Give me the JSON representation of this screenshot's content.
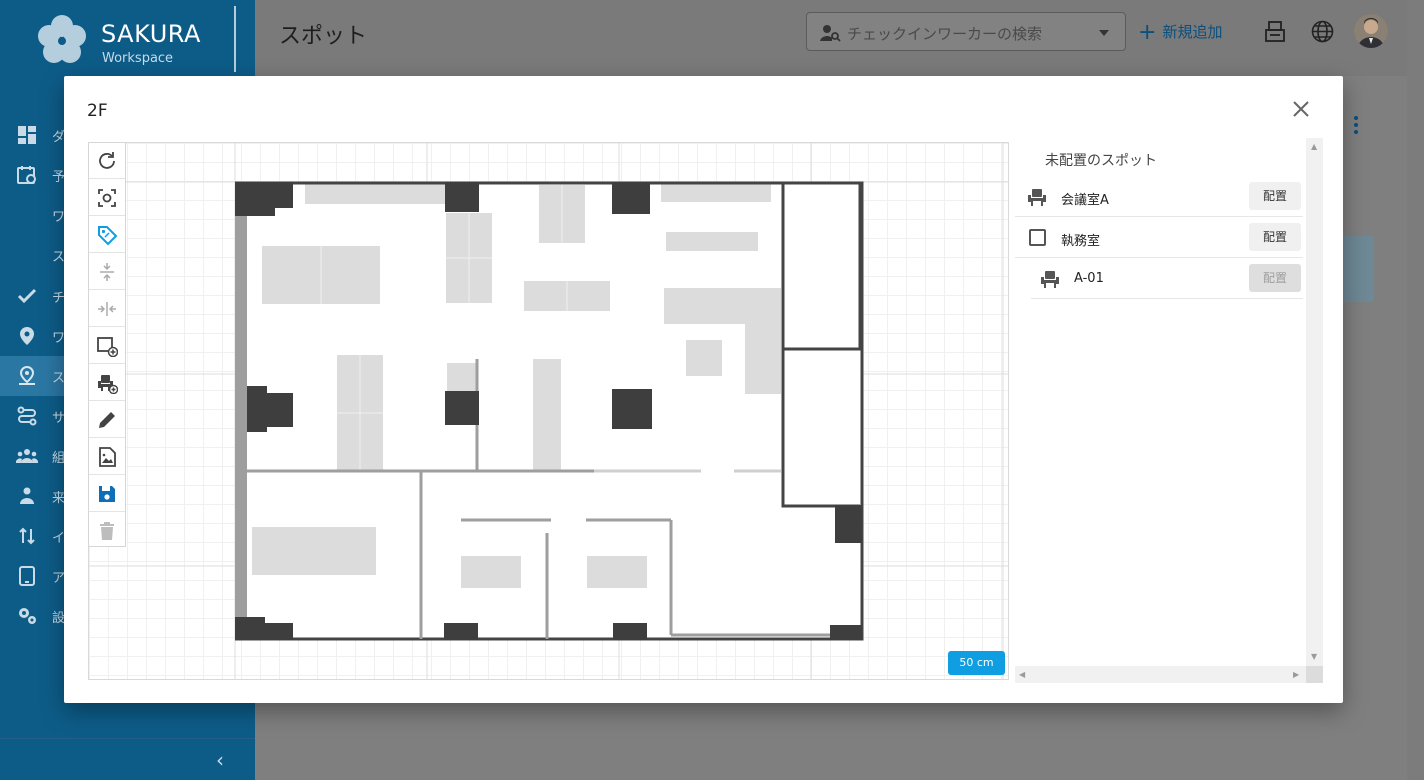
{
  "app": {
    "brand": "SAKURA",
    "brand_sub": "Workspace",
    "page_title": "スポット",
    "search_placeholder": "チェックインワーカーの検索",
    "add_new_label": "新規追加",
    "accent_color": "#0e9ee1",
    "sidebar_color": "#0d5c88"
  },
  "sidebar": {
    "items": [
      {
        "label": "ダ",
        "icon": "dashboard-icon"
      },
      {
        "label": "予",
        "icon": "calendar-icon"
      },
      {
        "label": "ワ",
        "icon": ""
      },
      {
        "label": "ス",
        "icon": ""
      },
      {
        "label": "チ",
        "icon": "check-icon"
      },
      {
        "label": "ワ",
        "icon": "location-pin-icon"
      },
      {
        "label": "ス",
        "icon": "spot-person-icon"
      },
      {
        "label": "サ",
        "icon": "route-icon"
      },
      {
        "label": "組",
        "icon": "group-icon"
      },
      {
        "label": "来",
        "icon": "visitor-icon"
      },
      {
        "label": "イ",
        "icon": "import-export-icon"
      },
      {
        "label": "ア",
        "icon": "tablet-icon"
      },
      {
        "label": "設",
        "icon": "settings-icon"
      }
    ]
  },
  "modal": {
    "title": "2F",
    "scale_label": "50 cm",
    "toolbar": [
      {
        "name": "rotate-tool-button",
        "icon": "rotate-icon"
      },
      {
        "name": "fit-view-tool-button",
        "icon": "focus-frame-icon"
      },
      {
        "name": "label-tool-button",
        "icon": "tag-icon"
      },
      {
        "name": "vertical-align-tool-button",
        "icon": "vertical-compress-icon"
      },
      {
        "name": "horizontal-align-tool-button",
        "icon": "horizontal-compress-icon"
      },
      {
        "name": "add-area-tool-button",
        "icon": "add-rectangle-icon"
      },
      {
        "name": "add-seat-tool-button",
        "icon": "add-seat-icon"
      },
      {
        "name": "edit-tool-button",
        "icon": "pencil-icon"
      },
      {
        "name": "image-tool-button",
        "icon": "image-file-icon"
      },
      {
        "name": "save-tool-button",
        "icon": "save-icon"
      },
      {
        "name": "delete-tool-button",
        "icon": "trash-icon"
      }
    ]
  },
  "spots": {
    "heading": "未配置のスポット",
    "items": [
      {
        "name": "会議室A",
        "icon": "seat-icon",
        "button": "配置",
        "disabled": false
      },
      {
        "name": "執務室",
        "icon": "checkbox",
        "button": "配置",
        "disabled": false
      },
      {
        "name": "A-01",
        "icon": "seat-icon",
        "button": "配置",
        "disabled": true
      }
    ]
  }
}
